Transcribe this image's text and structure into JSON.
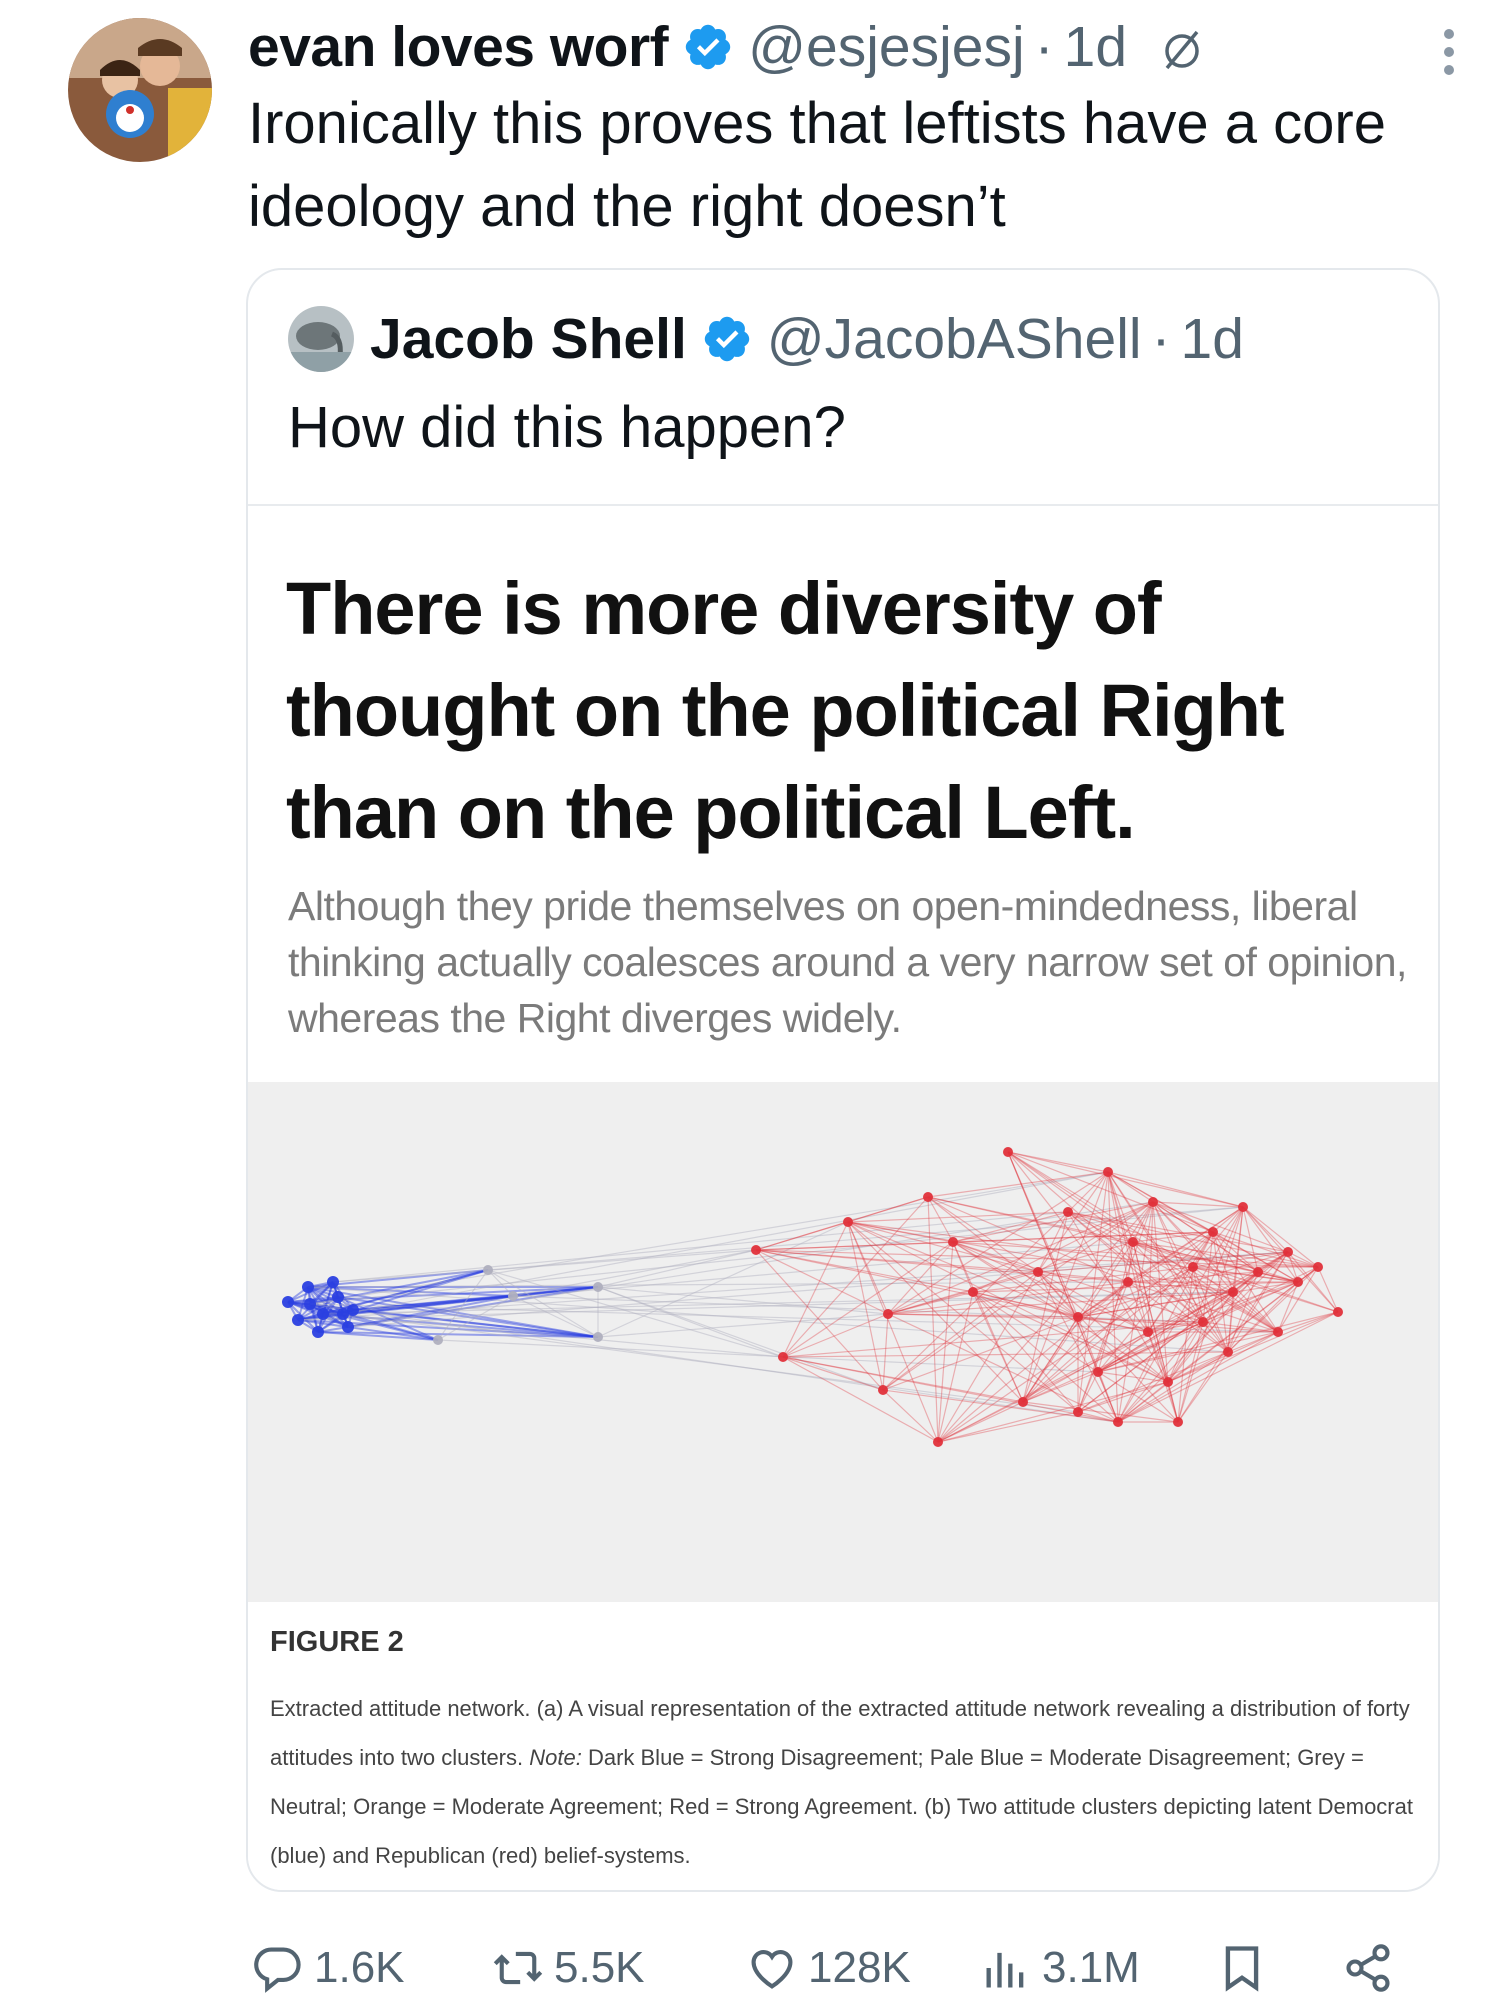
{
  "tweet": {
    "author_name": "evan loves worf",
    "handle": "@esjesjesj",
    "dot": "·",
    "time": "1d",
    "text": "Ironically this proves that leftists have a core ideology and the right doesn’t"
  },
  "quote": {
    "author_name": "Jacob Shell",
    "handle": "@JacobAShell",
    "dot": "·",
    "time": "1d",
    "text": "How did this happen?",
    "media": {
      "headline": "There is more diversity of thought on the political Right than on the political Left.",
      "subheadline": "Although they pride themselves on open-mindedness, liberal thinking actually coalesces around a very narrow set of opinion, whereas the Right diverges widely.",
      "figure_label": "FIGURE 2",
      "caption_1": "Extracted attitude network. (a) A visual representation of the extracted attitude network revealing a distribution of forty attitudes into two clusters. ",
      "caption_note": "Note:",
      "caption_2": " Dark Blue = Strong Disagreement; Pale Blue = Moderate Disagreement; Grey = Neutral; Orange = Moderate Agreement; Red = Strong Agreement. (b) Two attitude clusters depicting latent Democrat (blue) and Republican (red) belief-systems."
    }
  },
  "actions": {
    "replies": "1.6K",
    "reposts": "5.5K",
    "likes": "128K",
    "views": "3.1M"
  },
  "icons": [
    "verified-check-icon",
    "slash-circle-icon",
    "more-icon",
    "reply-icon",
    "repost-icon",
    "like-icon",
    "views-icon",
    "bookmark-icon",
    "share-icon"
  ],
  "colors": {
    "verified": "#1d9bf0",
    "secondary_text": "#536471",
    "network_blue": "#2a3fe0",
    "network_red": "#e0303a"
  }
}
